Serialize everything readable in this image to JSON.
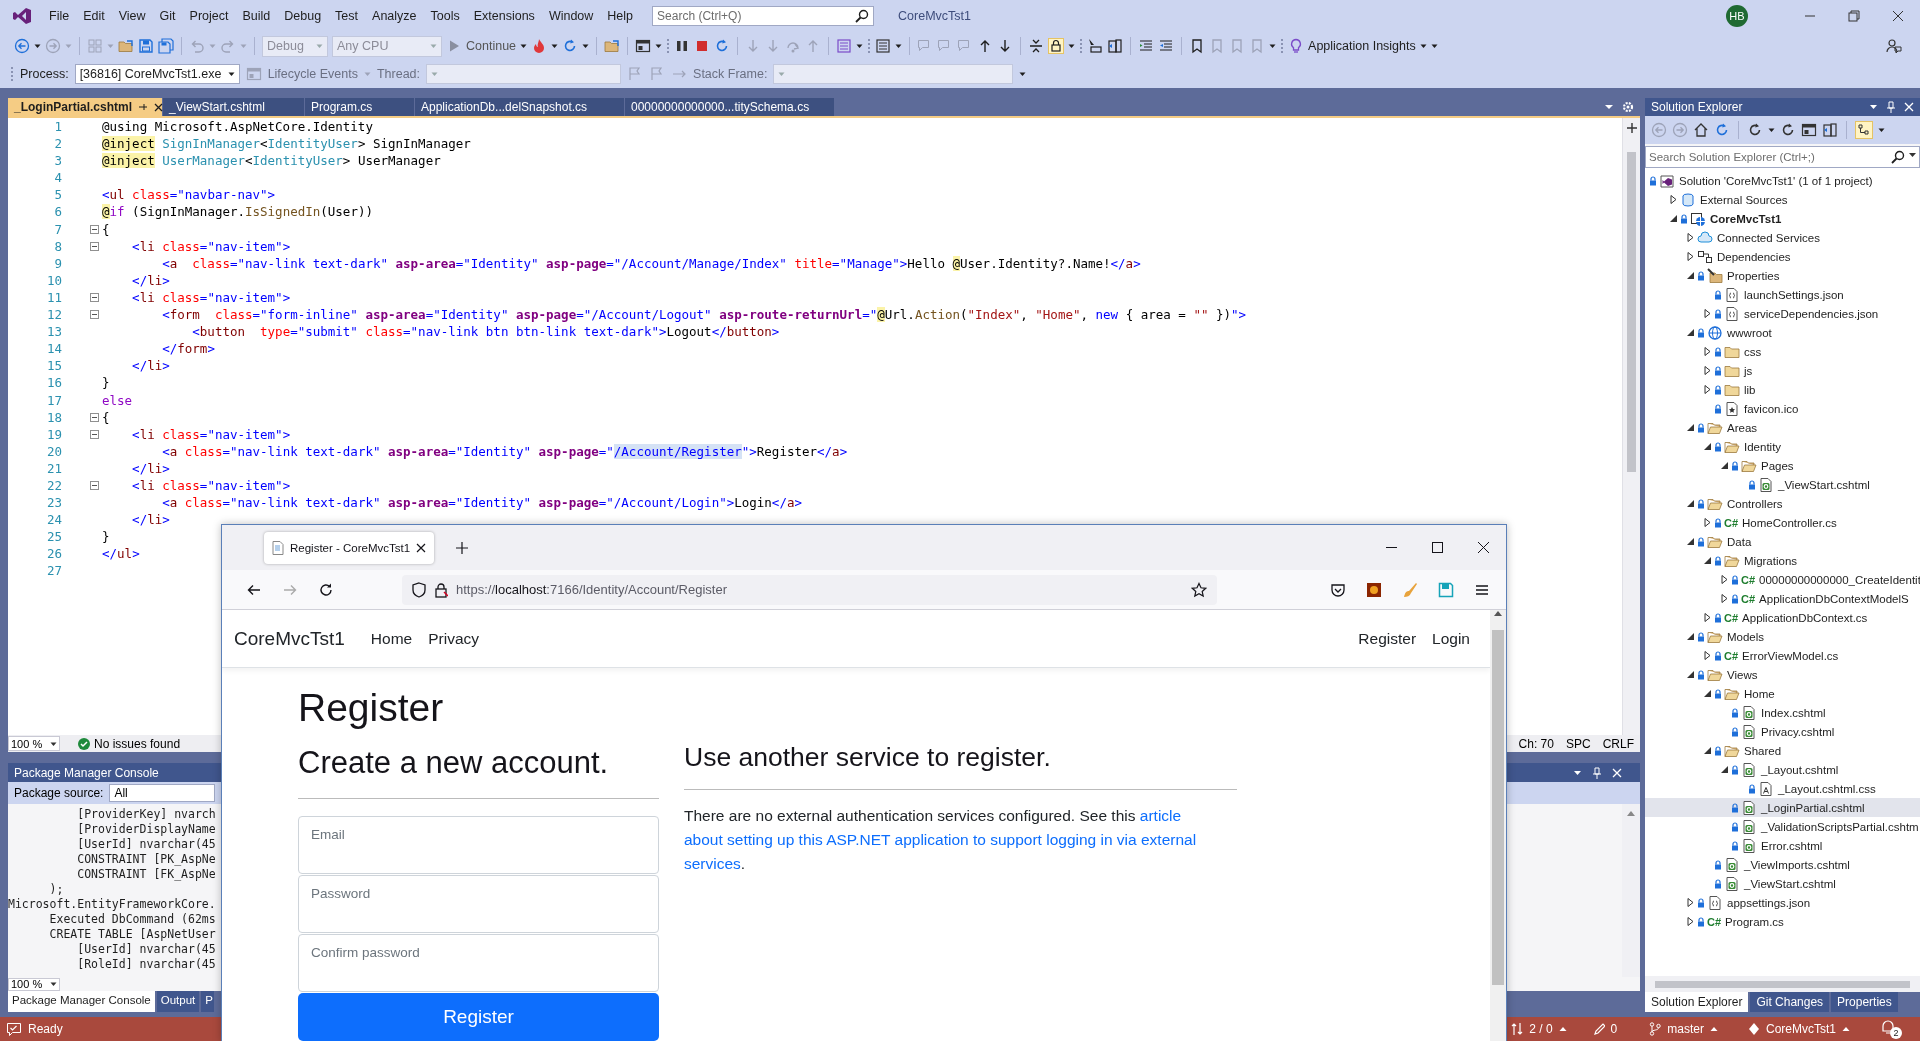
{
  "title_bar": {
    "menu": [
      "File",
      "Edit",
      "View",
      "Git",
      "Project",
      "Build",
      "Debug",
      "Test",
      "Analyze",
      "Tools",
      "Extensions",
      "Window",
      "Help"
    ],
    "search": {
      "placeholder": "Search (Ctrl+Q)"
    },
    "title": "CoreMvcTst1",
    "avatar": "HB"
  },
  "toolbar": {
    "configuration": {
      "value": "Debug",
      "disabled": true
    },
    "platform": {
      "value": "Any CPU",
      "disabled": true
    },
    "continue": "Continue",
    "insights": "Application Insights"
  },
  "debug_location": {
    "process_label": "Process:",
    "process": "[36816] CoreMvcTst1.exe",
    "lifecycle": "Lifecycle Events",
    "thread_label": "Thread:",
    "stack_label": "Stack Frame:"
  },
  "document_tabs": [
    {
      "label": "_LoginPartial.cshtml",
      "selected": true
    },
    {
      "label": "_ViewStart.cshtml",
      "selected": false
    },
    {
      "label": "Program.cs",
      "selected": false
    },
    {
      "label": "ApplicationDb...delSnapshot.cs",
      "selected": false
    },
    {
      "label": "00000000000000...titySchema.cs",
      "selected": false
    }
  ],
  "editor": {
    "lines": [
      {
        "number": "1",
        "fold": false,
        "tokens": [
          {
            "text": "@using",
            "kind": "plain"
          },
          {
            "text": " Microsoft.AspNetCore.Identity",
            "kind": "plain"
          }
        ]
      },
      {
        "number": "2",
        "fold": false,
        "tokens": [
          {
            "text": "@inject",
            "kind": "directive"
          },
          {
            "text": " SignInManager",
            "kind": "type"
          },
          {
            "text": "<",
            "kind": "plain"
          },
          {
            "text": "IdentityUser",
            "kind": "type"
          },
          {
            "text": "> SignInManager",
            "kind": "plain"
          }
        ]
      },
      {
        "number": "3",
        "fold": false,
        "tokens": [
          {
            "text": "@inject",
            "kind": "directive"
          },
          {
            "text": " UserManager",
            "kind": "type"
          },
          {
            "text": "<",
            "kind": "plain"
          },
          {
            "text": "IdentityUser",
            "kind": "type"
          },
          {
            "text": "> UserManager",
            "kind": "plain"
          }
        ]
      },
      {
        "number": "4",
        "fold": false
      },
      {
        "number": "5",
        "fold": false,
        "tokens": [
          {
            "text": "<",
            "kind": "delim"
          },
          {
            "text": "ul",
            "kind": "tag"
          },
          {
            "text": " class",
            "kind": "attr"
          },
          {
            "text": "=\"navbar-nav\">",
            "kind": "str"
          }
        ]
      },
      {
        "number": "6",
        "fold": false,
        "tokens": [
          {
            "text": "@",
            "kind": "directive"
          },
          {
            "text": "if",
            "kind": "keyword"
          },
          {
            "text": " (SignInManager.",
            "kind": "plain"
          },
          {
            "text": "IsSignedIn",
            "kind": "method"
          },
          {
            "text": "(User))",
            "kind": "plain"
          }
        ]
      },
      {
        "number": "7",
        "fold": true,
        "tokens": [
          {
            "text": "{",
            "kind": "plain"
          }
        ]
      },
      {
        "number": "8",
        "fold": true,
        "tokens": [
          {
            "text": "    <",
            "kind": "delim"
          },
          {
            "text": "li",
            "kind": "tag"
          },
          {
            "text": " class",
            "kind": "attr"
          },
          {
            "text": "=\"nav-item\">",
            "kind": "str"
          }
        ]
      },
      {
        "number": "9",
        "fold": false,
        "tokens": [
          {
            "text": "        <",
            "kind": "delim"
          },
          {
            "text": "a",
            "kind": "tag"
          },
          {
            "text": "  class",
            "kind": "attr"
          },
          {
            "text": "=\"nav-link text-dark\" ",
            "kind": "str"
          },
          {
            "text": "asp-area",
            "kind": "helper"
          },
          {
            "text": "=\"Identity\" ",
            "kind": "str"
          },
          {
            "text": "asp-page",
            "kind": "helper"
          },
          {
            "text": "=\"/Account/Manage/Index\" ",
            "kind": "str"
          },
          {
            "text": "title",
            "kind": "attr"
          },
          {
            "text": "=\"Manage\">",
            "kind": "str"
          },
          {
            "text": "Hello ",
            "kind": "plain"
          },
          {
            "text": "@",
            "kind": "directive"
          },
          {
            "text": "User.Identity?.Name!",
            "kind": "plain"
          },
          {
            "text": "</",
            "kind": "delim"
          },
          {
            "text": "a",
            "kind": "tag"
          },
          {
            "text": ">",
            "kind": "delim"
          }
        ]
      },
      {
        "number": "10",
        "fold": false,
        "tokens": [
          {
            "text": "    </",
            "kind": "delim"
          },
          {
            "text": "li",
            "kind": "tag"
          },
          {
            "text": ">",
            "kind": "delim"
          }
        ]
      },
      {
        "number": "11",
        "fold": true,
        "tokens": [
          {
            "text": "    <",
            "kind": "delim"
          },
          {
            "text": "li",
            "kind": "tag"
          },
          {
            "text": " class",
            "kind": "attr"
          },
          {
            "text": "=\"nav-item\">",
            "kind": "str"
          }
        ]
      },
      {
        "number": "12",
        "fold": true,
        "tokens": [
          {
            "text": "        <",
            "kind": "delim"
          },
          {
            "text": "form",
            "kind": "tag"
          },
          {
            "text": "  class",
            "kind": "attr"
          },
          {
            "text": "=\"form-inline\" ",
            "kind": "str"
          },
          {
            "text": "asp-area",
            "kind": "helper"
          },
          {
            "text": "=\"Identity\" ",
            "kind": "str"
          },
          {
            "text": "asp-page",
            "kind": "helper"
          },
          {
            "text": "=\"/Account/Logout\" ",
            "kind": "str"
          },
          {
            "text": "asp-route-returnUrl",
            "kind": "helper"
          },
          {
            "text": "=\"",
            "kind": "str"
          },
          {
            "text": "@",
            "kind": "directive"
          },
          {
            "text": "Url.",
            "kind": "plain"
          },
          {
            "text": "Action",
            "kind": "method"
          },
          {
            "text": "(",
            "kind": "plain"
          },
          {
            "text": "\"Index\"",
            "kind": "string"
          },
          {
            "text": ", ",
            "kind": "plain"
          },
          {
            "text": "\"Home\"",
            "kind": "string"
          },
          {
            "text": ", ",
            "kind": "plain"
          },
          {
            "text": "new",
            "kind": "blue"
          },
          {
            "text": " { area = ",
            "kind": "plain"
          },
          {
            "text": "\"\"",
            "kind": "string"
          },
          {
            "text": " })",
            "kind": "plain"
          },
          {
            "text": "\">",
            "kind": "str"
          }
        ]
      },
      {
        "number": "13",
        "fold": false,
        "tokens": [
          {
            "text": "            <",
            "kind": "delim"
          },
          {
            "text": "button",
            "kind": "tag"
          },
          {
            "text": "  type",
            "kind": "attr"
          },
          {
            "text": "=\"submit\" ",
            "kind": "str"
          },
          {
            "text": "class",
            "kind": "attr"
          },
          {
            "text": "=\"nav-link btn btn-link text-dark\">",
            "kind": "str"
          },
          {
            "text": "Logout",
            "kind": "plain"
          },
          {
            "text": "</",
            "kind": "delim"
          },
          {
            "text": "button",
            "kind": "tag"
          },
          {
            "text": ">",
            "kind": "delim"
          }
        ]
      },
      {
        "number": "14",
        "fold": false,
        "tokens": [
          {
            "text": "        </",
            "kind": "delim"
          },
          {
            "text": "form",
            "kind": "tag"
          },
          {
            "text": ">",
            "kind": "delim"
          }
        ]
      },
      {
        "number": "15",
        "fold": false,
        "tokens": [
          {
            "text": "    </",
            "kind": "delim"
          },
          {
            "text": "li",
            "kind": "tag"
          },
          {
            "text": ">",
            "kind": "delim"
          }
        ]
      },
      {
        "number": "16",
        "fold": false,
        "tokens": [
          {
            "text": "}",
            "kind": "plain"
          }
        ]
      },
      {
        "number": "17",
        "fold": false,
        "tokens": [
          {
            "text": "else",
            "kind": "keyword"
          }
        ]
      },
      {
        "number": "18",
        "fold": true,
        "tokens": [
          {
            "text": "{",
            "kind": "plain"
          }
        ]
      },
      {
        "number": "19",
        "fold": true,
        "tokens": [
          {
            "text": "    <",
            "kind": "delim"
          },
          {
            "text": "li",
            "kind": "tag"
          },
          {
            "text": " class",
            "kind": "attr"
          },
          {
            "text": "=\"nav-item\">",
            "kind": "str"
          }
        ]
      },
      {
        "number": "20",
        "fold": false,
        "tokens": [
          {
            "text": "        <",
            "kind": "delim"
          },
          {
            "text": "a",
            "kind": "tag"
          },
          {
            "text": " class",
            "kind": "attr"
          },
          {
            "text": "=\"nav-link text-dark\" ",
            "kind": "str"
          },
          {
            "text": "asp-area",
            "kind": "helper"
          },
          {
            "text": "=\"Identity\" ",
            "kind": "str"
          },
          {
            "text": "asp-page",
            "kind": "helper"
          },
          {
            "text": "=\"",
            "kind": "str"
          },
          {
            "text": "/Account/Register",
            "kind": "selection"
          },
          {
            "text": "\">",
            "kind": "str"
          },
          {
            "text": "Register",
            "kind": "plain"
          },
          {
            "text": "</",
            "kind": "delim"
          },
          {
            "text": "a",
            "kind": "tag"
          },
          {
            "text": ">",
            "kind": "delim"
          }
        ]
      },
      {
        "number": "21",
        "fold": false,
        "tokens": [
          {
            "text": "    </",
            "kind": "delim"
          },
          {
            "text": "li",
            "kind": "tag"
          },
          {
            "text": ">",
            "kind": "delim"
          }
        ]
      },
      {
        "number": "22",
        "fold": true,
        "tokens": [
          {
            "text": "    <",
            "kind": "delim"
          },
          {
            "text": "li",
            "kind": "tag"
          },
          {
            "text": " class",
            "kind": "attr"
          },
          {
            "text": "=\"nav-item\">",
            "kind": "str"
          }
        ]
      },
      {
        "number": "23",
        "fold": false,
        "tokens": [
          {
            "text": "        <",
            "kind": "delim"
          },
          {
            "text": "a",
            "kind": "tag"
          },
          {
            "text": " class",
            "kind": "attr"
          },
          {
            "text": "=\"nav-link text-dark\" ",
            "kind": "str"
          },
          {
            "text": "asp-area",
            "kind": "helper"
          },
          {
            "text": "=\"Identity\" ",
            "kind": "str"
          },
          {
            "text": "asp-page",
            "kind": "helper"
          },
          {
            "text": "=\"/Account/Login\">",
            "kind": "str"
          },
          {
            "text": "Login",
            "kind": "plain"
          },
          {
            "text": "</",
            "kind": "delim"
          },
          {
            "text": "a",
            "kind": "tag"
          },
          {
            "text": ">",
            "kind": "delim"
          }
        ]
      },
      {
        "number": "24",
        "fold": false,
        "tokens": [
          {
            "text": "    </",
            "kind": "delim"
          },
          {
            "text": "li",
            "kind": "tag"
          },
          {
            "text": ">",
            "kind": "delim"
          }
        ]
      },
      {
        "number": "25",
        "fold": false,
        "tokens": [
          {
            "text": "}",
            "kind": "plain"
          }
        ]
      },
      {
        "number": "26",
        "fold": false,
        "tokens": [
          {
            "text": "</",
            "kind": "delim"
          },
          {
            "text": "ul",
            "kind": "tag"
          },
          {
            "text": ">",
            "kind": "delim"
          }
        ]
      },
      {
        "number": "27",
        "fold": false
      }
    ],
    "zoom": "100 %",
    "issues": "No issues found",
    "position": "Ch: 70",
    "whitespace": "SPC",
    "line_ending": "CRLF"
  },
  "package_manager_console": {
    "title": "Package Manager Console",
    "source_label": "Package source:",
    "source": "All",
    "output": [
      "          [ProviderKey] nvarch",
      "          [ProviderDisplayName",
      "          [UserId] nvarchar(45",
      "          CONSTRAINT [PK_AspNe",
      "          CONSTRAINT [FK_AspNe",
      "      );",
      "Microsoft.EntityFrameworkCore.",
      "      Executed DbCommand (62ms",
      "      CREATE TABLE [AspNetUser",
      "          [UserId] nvarchar(45",
      "          [RoleId] nvarchar(45"
    ],
    "zoom": "100 %",
    "tabs": [
      {
        "label": "Package Manager Console",
        "selected": true
      },
      {
        "label": "Output",
        "selected": false
      },
      {
        "label": "P",
        "selected": false
      }
    ]
  },
  "solution_explorer": {
    "title": "Solution Explorer",
    "search": {
      "placeholder": "Search Solution Explorer (Ctrl+;)"
    },
    "tree": [
      {
        "label": "Solution 'CoreMvcTst1' (1 of 1 project)",
        "kind": "solution",
        "locked": true,
        "selected": false,
        "children": [
          {
            "label": "External Sources",
            "kind": "external",
            "locked": false,
            "selected": false,
            "expanded": false
          },
          {
            "label": "CoreMvcTst1",
            "kind": "project",
            "locked": true,
            "selected": false,
            "expanded": true,
            "children": [
              {
                "label": "Connected Services",
                "kind": "connected",
                "locked": false,
                "selected": false,
                "expanded": false
              },
              {
                "label": "Dependencies",
                "kind": "dependencies",
                "locked": false,
                "selected": false,
                "expanded": false
              },
              {
                "label": "Properties",
                "kind": "properties",
                "locked": true,
                "selected": false,
                "expanded": true,
                "children": [
                  {
                    "label": "launchSettings.json",
                    "kind": "json",
                    "locked": true,
                    "selected": false
                  },
                  {
                    "label": "serviceDependencies.json",
                    "kind": "json",
                    "locked": true,
                    "selected": false,
                    "expanded": false
                  }
                ]
              },
              {
                "label": "wwwroot",
                "kind": "web",
                "locked": true,
                "selected": false,
                "expanded": true,
                "children": [
                  {
                    "label": "css",
                    "kind": "folder",
                    "locked": true,
                    "selected": false,
                    "expanded": false
                  },
                  {
                    "label": "js",
                    "kind": "folder",
                    "locked": true,
                    "selected": false,
                    "expanded": false
                  },
                  {
                    "label": "lib",
                    "kind": "folder",
                    "locked": true,
                    "selected": false,
                    "expanded": false
                  },
                  {
                    "label": "favicon.ico",
                    "kind": "image",
                    "locked": true,
                    "selected": false
                  }
                ]
              },
              {
                "label": "Areas",
                "kind": "folder",
                "locked": true,
                "selected": false,
                "expanded": true,
                "children": [
                  {
                    "label": "Identity",
                    "kind": "folder",
                    "locked": true,
                    "selected": false,
                    "expanded": true,
                    "children": [
                      {
                        "label": "Pages",
                        "kind": "folder",
                        "locked": true,
                        "selected": false,
                        "expanded": true,
                        "children": [
                          {
                            "label": "_ViewStart.cshtml",
                            "kind": "razor",
                            "locked": true,
                            "selected": false
                          }
                        ]
                      }
                    ]
                  }
                ]
              },
              {
                "label": "Controllers",
                "kind": "folder",
                "locked": true,
                "selected": false,
                "expanded": true,
                "children": [
                  {
                    "label": "HomeController.cs",
                    "kind": "csharp",
                    "badge": "C#",
                    "locked": true,
                    "selected": false,
                    "expanded": false
                  }
                ]
              },
              {
                "label": "Data",
                "kind": "folder",
                "locked": true,
                "selected": false,
                "expanded": true,
                "children": [
                  {
                    "label": "Migrations",
                    "kind": "folder",
                    "locked": true,
                    "selected": false,
                    "expanded": true,
                    "children": [
                      {
                        "label": "00000000000000_CreateIdentit",
                        "kind": "csharp",
                        "badge": "C#",
                        "locked": true,
                        "selected": false,
                        "expanded": false
                      },
                      {
                        "label": "ApplicationDbContextModelS",
                        "kind": "csharp",
                        "badge": "C#",
                        "locked": true,
                        "selected": false,
                        "expanded": false
                      }
                    ]
                  },
                  {
                    "label": "ApplicationDbContext.cs",
                    "kind": "csharp",
                    "badge": "C#",
                    "locked": true,
                    "selected": false,
                    "expanded": false
                  }
                ]
              },
              {
                "label": "Models",
                "kind": "folder",
                "locked": true,
                "selected": false,
                "expanded": true,
                "children": [
                  {
                    "label": "ErrorViewModel.cs",
                    "kind": "csharp",
                    "badge": "C#",
                    "locked": true,
                    "selected": false,
                    "expanded": false
                  }
                ]
              },
              {
                "label": "Views",
                "kind": "folder",
                "locked": true,
                "selected": false,
                "expanded": true,
                "children": [
                  {
                    "label": "Home",
                    "kind": "folder",
                    "locked": true,
                    "selected": false,
                    "expanded": true,
                    "children": [
                      {
                        "label": "Index.cshtml",
                        "kind": "razor",
                        "locked": true,
                        "selected": false
                      },
                      {
                        "label": "Privacy.cshtml",
                        "kind": "razor",
                        "locked": true,
                        "selected": false
                      }
                    ]
                  },
                  {
                    "label": "Shared",
                    "kind": "folder",
                    "locked": true,
                    "selected": false,
                    "expanded": true,
                    "children": [
                      {
                        "label": "_Layout.cshtml",
                        "kind": "razor",
                        "locked": true,
                        "selected": false,
                        "expanded": true,
                        "children": [
                          {
                            "label": "_Layout.cshtml.css",
                            "kind": "stylesheet",
                            "locked": true,
                            "selected": false
                          }
                        ]
                      },
                      {
                        "label": "_LoginPartial.cshtml",
                        "kind": "razor",
                        "locked": true,
                        "selected": true
                      },
                      {
                        "label": "_ValidationScriptsPartial.cshtm",
                        "kind": "razor",
                        "locked": true,
                        "selected": false
                      },
                      {
                        "label": "Error.cshtml",
                        "kind": "razor",
                        "locked": true,
                        "selected": false
                      }
                    ]
                  },
                  {
                    "label": "_ViewImports.cshtml",
                    "kind": "razor",
                    "locked": true,
                    "selected": false
                  },
                  {
                    "label": "_ViewStart.cshtml",
                    "kind": "razor",
                    "locked": true,
                    "selected": false
                  }
                ]
              },
              {
                "label": "appsettings.json",
                "kind": "json",
                "locked": true,
                "selected": false,
                "expanded": false
              },
              {
                "label": "Program.cs",
                "kind": "csharp",
                "badge": "C#",
                "locked": true,
                "selected": false,
                "expanded": false
              }
            ]
          }
        ]
      }
    ],
    "tabs": [
      {
        "label": "Solution Explorer",
        "selected": true
      },
      {
        "label": "Git Changes",
        "selected": false
      },
      {
        "label": "Properties",
        "selected": false
      }
    ]
  },
  "status_bar": {
    "status": "Ready",
    "changes": "2 / 0",
    "edits": "0",
    "branch": "master",
    "repository": "CoreMvcTst1",
    "notifications": "2"
  },
  "browser": {
    "tab_title": "Register - CoreMvcTst1",
    "can_go_forward": false,
    "url": {
      "scheme": "https://",
      "host": "localhost",
      "path": ":7166/Identity/Account/Register"
    },
    "page": {
      "brand": "CoreMvcTst1",
      "nav": [
        "Home",
        "Privacy"
      ],
      "nav_right": [
        "Register",
        "Login"
      ],
      "heading": "Register",
      "form_title": "Create a new account.",
      "fields": [
        {
          "placeholder": "Email"
        },
        {
          "placeholder": "Password"
        },
        {
          "placeholder": "Confirm password"
        }
      ],
      "submit": "Register",
      "external_title": "Use another service to register.",
      "external_text": "There are no external authentication services configured. See this ",
      "external_link": [
        "article",
        "about setting up this ASP.NET application to support logging in via external",
        "services"
      ],
      "external_end": "."
    }
  }
}
